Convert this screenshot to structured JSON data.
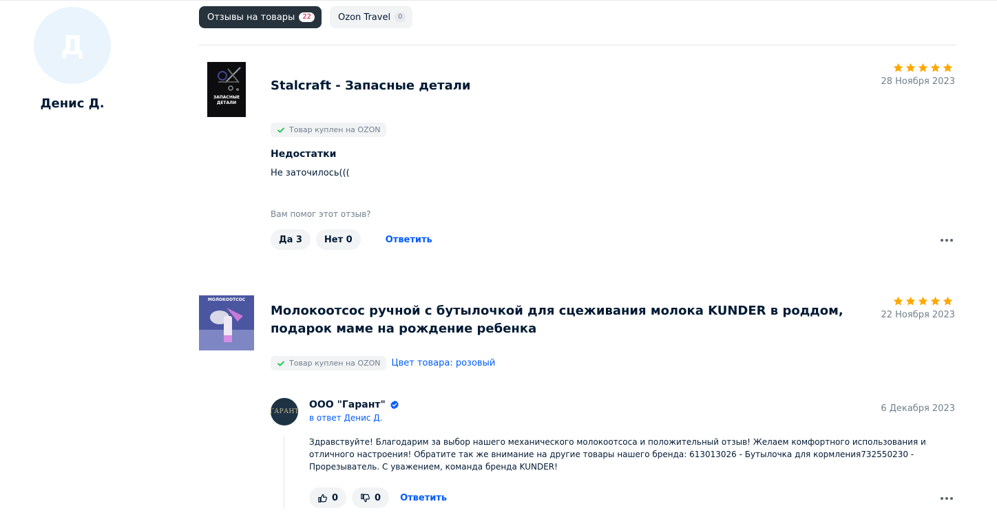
{
  "profile": {
    "initial": "Д",
    "name": "Денис Д."
  },
  "tabs": [
    {
      "label": "Отзывы на товары",
      "count": "22",
      "active": true
    },
    {
      "label": "Ozon Travel",
      "count": "0",
      "active": false
    }
  ],
  "colors": {
    "accent": "#005bff",
    "star": "#ffa800",
    "verified": "#005bff",
    "check": "#10c44c"
  },
  "reviews": [
    {
      "title": "Stalcraft - Запасные детали",
      "thumb_text": "ЗАПАСНЫЕ ДЕТАЛИ",
      "rating": 5,
      "date": "28 Ноября 2023",
      "badge": "Товар куплен на OZON",
      "section_title": "Недостатки",
      "text": "Не заточилось(((",
      "helpful_question": "Вам помог этот отзыв?",
      "yes_label": "Да 3",
      "no_label": "Нет 0",
      "reply_label": "Ответить"
    },
    {
      "title": "Молокоотсос ручной с бутылочкой для сцеживания молока KUNDER в роддом, подарок маме на рождение ребенка",
      "thumb_text": "МОЛОКООТСОС",
      "rating": 5,
      "date": "22 Ноября 2023",
      "badge": "Товар куплен на OZON",
      "color_label": "Цвет товара: розовый",
      "seller_reply": {
        "avatar_text": "ГАРАНТ",
        "name": "ООО \"Гарант\"",
        "in_reply": "в ответ Денис Д.",
        "date": "6 Декабря 2023",
        "text": "Здравствуйте! Благодарим за выбор нашего механического молокоотсоса и положительный отзыв! Желаем комфортного использования и отличного настроения! Обратите так же внимание на другие товары нашего бренда: 613013026 - Бутылочка для кормления732550230 - Прорезыватель. С уважением, команда бренда KUNDER!",
        "likes": "0",
        "dislikes": "0",
        "reply_label": "Ответить"
      }
    }
  ]
}
